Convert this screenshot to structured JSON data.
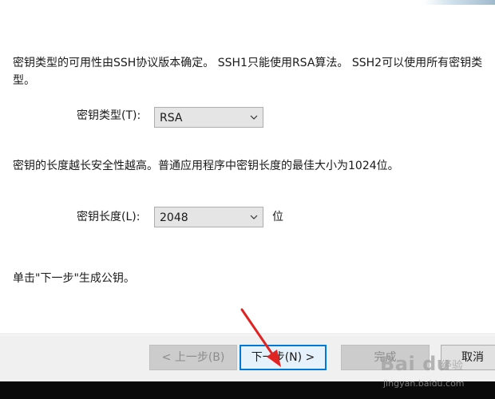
{
  "dialog": {
    "key_type_description": "密钥类型的可用性由SSH协议版本确定。 SSH1只能使用RSA算法。 SSH2可以使用所有密钥类型。",
    "key_type_label": "密钥类型(T):",
    "key_type_value": "RSA",
    "key_length_description": "密钥的长度越长安全性越高。普通应用程序中密钥长度的最佳大小为1024位。",
    "key_length_label": "密钥长度(L):",
    "key_length_value": "2048",
    "key_length_unit": "位",
    "instruction": "单击\"下一步\"生成公钥。"
  },
  "buttons": {
    "back": "< 上一步(B)",
    "next": "下一步(N) >",
    "finish": "完成",
    "cancel": "取消"
  },
  "watermark": {
    "logo": "Bai du",
    "text": "经验",
    "url": "jingyan.baidu.com"
  },
  "colors": {
    "accent": "#0078d7",
    "annotation_arrow": "#e02424"
  },
  "icons": {
    "combo_dropdown": "chevron-down-icon",
    "annotation": "red-arrow-icon"
  }
}
